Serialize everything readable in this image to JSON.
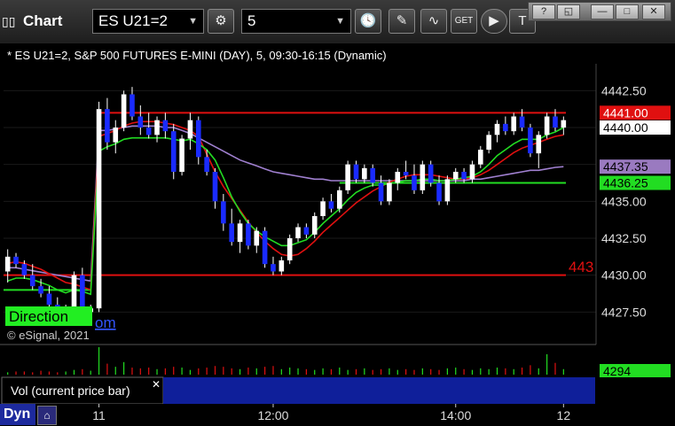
{
  "toolbar": {
    "title": "Chart",
    "symbol": "ES U21=2",
    "interval": "5",
    "window_buttons": [
      "?",
      "◱",
      "—",
      "□",
      "✕"
    ]
  },
  "chart_data": {
    "type": "candlestick",
    "title": "* ES U21=2, S&P 500 FUTURES E-MINI (DAY), 5, 09:30-16:15 (Dynamic)",
    "copyright": "© eSignal, 2021",
    "direction_label": "Direction",
    "direction_suffix": "om",
    "y_ticks": [
      4442.5,
      4440.0,
      4437.5,
      4435.0,
      4432.5,
      4430.0,
      4427.5
    ],
    "y_tick_labels": [
      "4442.50",
      "4440.00",
      "4437.35",
      "4435.00",
      "4432.50",
      "4430.00",
      "4427.50"
    ],
    "ylim": [
      4425.6,
      4444.2
    ],
    "x_ticks": [
      "11",
      "12:00",
      "14:00",
      "12"
    ],
    "price_labels": [
      {
        "text": "4441.00",
        "value": 4441.0,
        "bg": "#e01010",
        "fg": "#ffffff"
      },
      {
        "text": "4440.00",
        "value": 4440.0,
        "bg": "#ffffff",
        "fg": "#000000"
      },
      {
        "text": "4437.35",
        "value": 4437.35,
        "bg": "#9a7ac0",
        "fg": "#000000"
      },
      {
        "text": "4436.25",
        "value": 4436.25,
        "bg": "#22dd22",
        "fg": "#000000"
      }
    ],
    "hlines": [
      {
        "value": 4441.0,
        "color": "#e01010"
      },
      {
        "value": 4430.0,
        "color": "#e01010"
      },
      {
        "value": 4436.25,
        "color": "#22dd22"
      }
    ],
    "hline_label": "443",
    "series_colors": {
      "up": "#ffffff",
      "down": "#1a2bff",
      "ma_fast": "#22dd22",
      "ma_slow": "#e01010",
      "ma_long": "#a080d0"
    },
    "candles": [
      [
        4430.25,
        4431.75,
        4429.5,
        4431.25
      ],
      [
        4431.25,
        4431.5,
        4430.5,
        4430.75
      ],
      [
        4430.75,
        4431.0,
        4429.75,
        4430.0
      ],
      [
        4430.0,
        4430.75,
        4429.0,
        4429.25
      ],
      [
        4429.25,
        4429.75,
        4428.5,
        4428.75
      ],
      [
        4428.75,
        4429.25,
        4427.75,
        4428.0
      ],
      [
        4428.0,
        4428.5,
        4427.0,
        4427.25
      ],
      [
        4427.25,
        4428.0,
        4426.75,
        4427.75
      ],
      [
        4427.75,
        4430.25,
        4427.5,
        4430.0
      ],
      [
        4430.0,
        4430.5,
        4427.25,
        4427.5
      ],
      [
        4427.5,
        4428.0,
        4427.0,
        4427.75
      ],
      [
        4427.75,
        4441.75,
        4427.5,
        4441.25
      ],
      [
        4441.25,
        4442.0,
        4438.5,
        4439.0
      ],
      [
        4439.0,
        4440.5,
        4438.25,
        4440.0
      ],
      [
        4440.0,
        4442.5,
        4439.75,
        4442.25
      ],
      [
        4442.25,
        4442.75,
        4440.5,
        4440.75
      ],
      [
        4440.75,
        4441.5,
        4439.5,
        4440.0
      ],
      [
        4440.0,
        4441.0,
        4439.25,
        4439.5
      ],
      [
        4439.5,
        4440.75,
        4439.0,
        4440.5
      ],
      [
        4440.5,
        4441.0,
        4439.25,
        4439.75
      ],
      [
        4439.75,
        4440.25,
        4436.5,
        4437.0
      ],
      [
        4437.0,
        4439.5,
        4436.75,
        4439.25
      ],
      [
        4439.25,
        4441.0,
        4438.5,
        4440.5
      ],
      [
        4440.5,
        4440.75,
        4437.5,
        4438.0
      ],
      [
        4438.0,
        4438.5,
        4436.75,
        4437.0
      ],
      [
        4437.0,
        4437.25,
        4434.5,
        4435.0
      ],
      [
        4435.0,
        4435.5,
        4433.0,
        4433.5
      ],
      [
        4433.5,
        4434.5,
        4432.0,
        4432.25
      ],
      [
        4432.25,
        4433.75,
        4431.5,
        4433.5
      ],
      [
        4433.5,
        4433.75,
        4431.75,
        4432.0
      ],
      [
        4432.0,
        4433.25,
        4431.5,
        4433.0
      ],
      [
        4433.0,
        4433.25,
        4430.5,
        4430.75
      ],
      [
        4430.75,
        4431.25,
        4430.0,
        4430.25
      ],
      [
        4430.25,
        4431.25,
        4430.0,
        4431.0
      ],
      [
        4431.0,
        4432.75,
        4430.75,
        4432.5
      ],
      [
        4432.5,
        4433.5,
        4432.25,
        4433.25
      ],
      [
        4433.25,
        4433.5,
        4432.5,
        4432.75
      ],
      [
        4432.75,
        4434.25,
        4432.5,
        4434.0
      ],
      [
        4434.0,
        4435.25,
        4433.75,
        4435.0
      ],
      [
        4435.0,
        4435.5,
        4434.25,
        4434.5
      ],
      [
        4434.5,
        4436.0,
        4434.25,
        4435.75
      ],
      [
        4435.75,
        4437.75,
        4435.5,
        4437.5
      ],
      [
        4437.5,
        4437.75,
        4436.25,
        4436.5
      ],
      [
        4436.5,
        4437.5,
        4436.25,
        4437.25
      ],
      [
        4437.25,
        4437.5,
        4436.0,
        4436.25
      ],
      [
        4436.25,
        4436.75,
        4434.75,
        4435.0
      ],
      [
        4435.0,
        4436.5,
        4434.75,
        4436.25
      ],
      [
        4436.25,
        4437.25,
        4435.75,
        4437.0
      ],
      [
        4437.0,
        4437.75,
        4436.5,
        4436.75
      ],
      [
        4436.75,
        4437.5,
        4435.5,
        4435.75
      ],
      [
        4435.75,
        4437.75,
        4435.5,
        4437.5
      ],
      [
        4437.5,
        4437.75,
        4436.0,
        4436.25
      ],
      [
        4436.25,
        4436.75,
        4434.75,
        4435.0
      ],
      [
        4435.0,
        4436.75,
        4434.75,
        4436.5
      ],
      [
        4436.5,
        4437.25,
        4436.25,
        4437.0
      ],
      [
        4437.0,
        4437.25,
        4436.25,
        4436.5
      ],
      [
        4436.5,
        4437.75,
        4436.25,
        4437.5
      ],
      [
        4437.5,
        4438.75,
        4437.25,
        4438.5
      ],
      [
        4438.5,
        4439.75,
        4438.25,
        4439.5
      ],
      [
        4439.5,
        4440.5,
        4439.0,
        4440.25
      ],
      [
        4440.25,
        4440.75,
        4439.5,
        4439.75
      ],
      [
        4439.75,
        4441.0,
        4439.5,
        4440.75
      ],
      [
        4440.75,
        4441.25,
        4439.75,
        4440.0
      ],
      [
        4440.0,
        4440.25,
        4438.0,
        4438.25
      ],
      [
        4438.25,
        4439.75,
        4437.25,
        4439.5
      ],
      [
        4439.5,
        4441.0,
        4439.25,
        4440.75
      ],
      [
        4440.75,
        4441.25,
        4439.75,
        4440.0
      ],
      [
        4440.0,
        4440.75,
        4439.5,
        4440.5
      ]
    ],
    "ma_fast": [
      4429.6,
      4429.8,
      4429.8,
      4429.7,
      4429.5,
      4429.3,
      4429.0,
      4428.8,
      4429.0,
      4428.9,
      4428.7,
      4438.4,
      4438.7,
      4438.9,
      4439.2,
      4439.3,
      4439.3,
      4439.3,
      4439.3,
      4439.3,
      4439.2,
      4439.1,
      4439.2,
      4438.9,
      4438.5,
      4437.8,
      4436.6,
      4435.3,
      4434.3,
      4433.5,
      4433.0,
      4432.6,
      4432.3,
      4432.0,
      4432.0,
      4432.2,
      4432.4,
      4432.9,
      4433.5,
      4434.0,
      4434.5,
      4435.1,
      4435.6,
      4435.9,
      4436.1,
      4436.1,
      4436.2,
      4436.3,
      4436.4,
      4436.4,
      4436.5,
      4436.5,
      4436.4,
      4436.4,
      4436.5,
      4436.6,
      4436.7,
      4437.0,
      4437.5,
      4438.1,
      4438.5,
      4438.9,
      4439.2,
      4439.2,
      4439.2,
      4439.5,
      4439.7,
      4440.0
    ],
    "ma_slow": [
      4430.8,
      4430.9,
      4430.8,
      4430.6,
      4430.4,
      4430.1,
      4429.8,
      4429.5,
      4429.4,
      4429.2,
      4429.0,
      4439.4,
      4439.6,
      4439.8,
      4440.1,
      4440.3,
      4440.4,
      4440.4,
      4440.4,
      4440.3,
      4440.2,
      4440.0,
      4439.8,
      4439.4,
      4438.2,
      4437.0,
      4436.0,
      4435.2,
      4434.4,
      4433.6,
      4432.9,
      4432.3,
      4431.8,
      4431.4,
      4431.3,
      4431.4,
      4431.8,
      4432.3,
      4432.9,
      4433.4,
      4433.9,
      4434.4,
      4434.9,
      4435.3,
      4435.7,
      4436.0,
      4436.3,
      4436.5,
      4436.7,
      4436.8,
      4436.8,
      4436.8,
      4436.7,
      4436.6,
      4436.5,
      4436.5,
      4436.6,
      4436.8,
      4437.1,
      4437.5,
      4437.9,
      4438.3,
      4438.6,
      4438.8,
      4439.0,
      4439.2,
      4439.4,
      4439.5
    ],
    "ma_long": [
      4430.5,
      4430.5,
      4430.4,
      4430.3,
      4430.2,
      4430.1,
      4430.0,
      4429.9,
      4429.8,
      4429.7,
      4429.6,
      4439.8,
      4439.8,
      4439.9,
      4440.0,
      4440.1,
      4440.1,
      4440.1,
      4440.1,
      4440.0,
      4440.0,
      4439.8,
      4439.6,
      4439.3,
      4439.0,
      4438.7,
      4438.4,
      4438.1,
      4437.8,
      4437.6,
      4437.4,
      4437.2,
      4437.0,
      4436.9,
      4436.8,
      4436.7,
      4436.6,
      4436.5,
      4436.5,
      4436.4,
      4436.4,
      4436.4,
      4436.4,
      4436.4,
      4436.4,
      4436.4,
      4436.4,
      4436.4,
      4436.4,
      4436.4,
      4436.4,
      4436.4,
      4436.4,
      4436.4,
      4436.4,
      4436.4,
      4436.5,
      4436.5,
      4436.6,
      4436.7,
      4436.8,
      4436.9,
      4437.0,
      4437.1,
      4437.1,
      4437.2,
      4437.3,
      4437.35
    ],
    "volume": {
      "label": "Vol (current price bar)",
      "last_value_text": "4294",
      "values": [
        3,
        4,
        4,
        3,
        5,
        4,
        3,
        4,
        6,
        7,
        5,
        35,
        14,
        10,
        16,
        9,
        8,
        9,
        7,
        8,
        10,
        9,
        6,
        8,
        9,
        11,
        10,
        8,
        7,
        9,
        8,
        10,
        11,
        7,
        9,
        8,
        7,
        6,
        8,
        7,
        9,
        6,
        7,
        8,
        6,
        7,
        8,
        6,
        7,
        6,
        8,
        7,
        6,
        8,
        9,
        7,
        6,
        8,
        7,
        9,
        8,
        7,
        9,
        12,
        8,
        26,
        15,
        7
      ]
    }
  }
}
